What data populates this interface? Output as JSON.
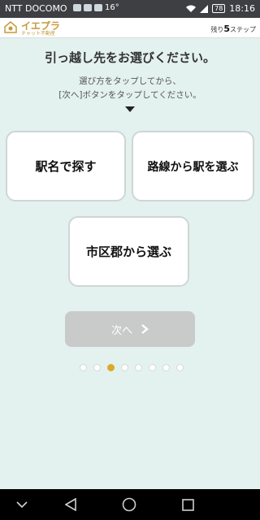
{
  "status_bar": {
    "carrier": "NTT DOCOMO",
    "temperature": "16°",
    "battery": "78",
    "time": "18:16"
  },
  "header": {
    "logo_text": "イエプラ",
    "logo_sub": "チャット不動産",
    "steps_prefix": "残り",
    "steps_count": "5",
    "steps_suffix": "ステップ"
  },
  "main": {
    "title": "引っ越し先をお選びください。",
    "instruction_line1": "選び方をタップしてから、",
    "instruction_line2": "[次へ]ボタンをタップしてください。",
    "choices": [
      {
        "label": "駅名で探す"
      },
      {
        "label": "路線から駅を選ぶ"
      },
      {
        "label": "市区郡から選ぶ"
      }
    ],
    "next_label": "次へ",
    "pagination": {
      "total": 8,
      "active_index": 2
    }
  },
  "colors": {
    "background": "#e3f1ef",
    "accent": "#d9aa28",
    "next_disabled": "#c9cbcb"
  },
  "icons": {
    "status": [
      "wifi-icon",
      "signal-icon",
      "battery-icon"
    ],
    "nav": [
      "chevron-down-icon",
      "back-triangle-icon",
      "home-circle-icon",
      "recent-square-icon"
    ]
  }
}
